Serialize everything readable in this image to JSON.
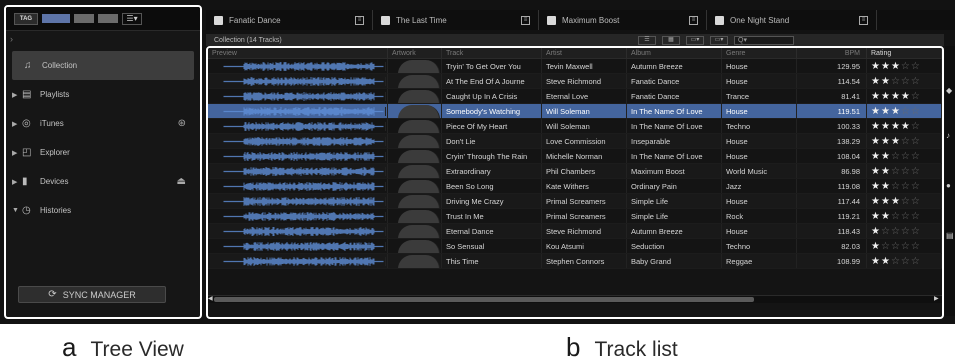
{
  "tree": {
    "tag_label": "TAG",
    "items": [
      {
        "label": "Collection",
        "icon": "collection-icon",
        "selected": true
      },
      {
        "label": "Playlists",
        "icon": "playlist-icon"
      },
      {
        "label": "iTunes",
        "icon": "itunes-icon",
        "right_icon": "sync-icon"
      },
      {
        "label": "Explorer",
        "icon": "explorer-icon"
      },
      {
        "label": "Devices",
        "icon": "device-icon",
        "right_icon": "eject-icon"
      },
      {
        "label": "Histories",
        "icon": "history-icon"
      }
    ],
    "sync_label": "SYNC MANAGER"
  },
  "decks": [
    {
      "title": "Fanatic Dance"
    },
    {
      "title": "The Last Time"
    },
    {
      "title": "Maximum Boost"
    },
    {
      "title": "One Night Stand"
    }
  ],
  "collection_title": "Collection (14 Tracks)",
  "search_placeholder": "Q▾",
  "columns": [
    "Preview",
    "Artwork",
    "Track",
    "Artist",
    "Album",
    "Genre",
    "BPM",
    "Rating"
  ],
  "tracks": [
    {
      "track": "Tryin' To Get Over You",
      "artist": "Tevin Maxwell",
      "album": "Autumn Breeze",
      "genre": "House",
      "bpm": "129.95",
      "rating": 3
    },
    {
      "track": "At The End Of A Journe",
      "artist": "Steve Richmond",
      "album": "Fanatic Dance",
      "genre": "House",
      "bpm": "114.54",
      "rating": 2
    },
    {
      "track": "Caught Up In A Crisis",
      "artist": "Eternal Love",
      "album": "Fanatic Dance",
      "genre": "Trance",
      "bpm": "81.41",
      "rating": 4
    },
    {
      "track": "Somebody's Watching",
      "artist": "Will Soleman",
      "album": "In The Name Of Love",
      "genre": "House",
      "bpm": "119.51",
      "rating": 3,
      "selected": true
    },
    {
      "track": "Piece Of My Heart",
      "artist": "Will Soleman",
      "album": "In The Name Of Love",
      "genre": "Techno",
      "bpm": "100.33",
      "rating": 4
    },
    {
      "track": "Don't Lie",
      "artist": "Love Commission",
      "album": "Inseparable",
      "genre": "House",
      "bpm": "138.29",
      "rating": 3
    },
    {
      "track": "Cryin' Through The Rain",
      "artist": "Michelle Norman",
      "album": "In The Name Of Love",
      "genre": "House",
      "bpm": "108.04",
      "rating": 2
    },
    {
      "track": "Extraordinary",
      "artist": "Phil Chambers",
      "album": "Maximum Boost",
      "genre": "World Music",
      "bpm": "86.98",
      "rating": 2
    },
    {
      "track": "Been So Long",
      "artist": "Kate Withers",
      "album": "Ordinary Pain",
      "genre": "Jazz",
      "bpm": "119.08",
      "rating": 2
    },
    {
      "track": "Driving Me Crazy",
      "artist": "Primal Screamers",
      "album": "Simple Life",
      "genre": "House",
      "bpm": "117.44",
      "rating": 3
    },
    {
      "track": "Trust In Me",
      "artist": "Primal Screamers",
      "album": "Simple Life",
      "genre": "Rock",
      "bpm": "119.21",
      "rating": 2
    },
    {
      "track": "Eternal Dance",
      "artist": "Steve Richmond",
      "album": "Autumn Breeze",
      "genre": "House",
      "bpm": "118.43",
      "rating": 1
    },
    {
      "track": "So Sensual",
      "artist": "Kou Atsumi",
      "album": "Seduction",
      "genre": "Techno",
      "bpm": "82.03",
      "rating": 1
    },
    {
      "track": "This Time",
      "artist": "Stephen Connors",
      "album": "Baby Grand",
      "genre": "Reggae",
      "bpm": "108.99",
      "rating": 2
    }
  ],
  "labels": {
    "a_letter": "a",
    "a_text": "Tree View",
    "b_letter": "b",
    "b_text": "Track list"
  }
}
